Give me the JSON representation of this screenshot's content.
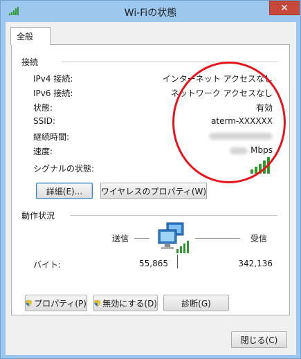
{
  "window": {
    "title": "Wi-Fiの状態",
    "close_label": "✕",
    "tab_label": "全般"
  },
  "connection": {
    "section_title": "接続",
    "rows": [
      {
        "label": "IPv4 接続:",
        "value": "インターネット アクセスなし"
      },
      {
        "label": "IPv6 接続:",
        "value": "ネットワーク アクセスなし"
      },
      {
        "label": "状態:",
        "value": "有効"
      },
      {
        "label": "SSID:",
        "value": "aterm-XXXXXX"
      },
      {
        "label": "継続時間:",
        "value": ""
      },
      {
        "label": "速度:",
        "value": "Mbps"
      }
    ],
    "signal_label": "シグナルの状態:",
    "signal_bars": 5,
    "signal_color": "#2e9a2e",
    "details_button": "詳細(E)...",
    "wireless_props_button": "ワイヤレスのプロパティ(W)"
  },
  "activity": {
    "section_title": "動作状況",
    "sent_label": "送信",
    "received_label": "受信",
    "bytes_label": "バイト:",
    "bytes_sent": "55,865",
    "bytes_received": "342,136"
  },
  "actions": {
    "properties_button": "プロパティ(P)",
    "disable_button": "無効にする(D)",
    "diagnose_button": "診断(G)"
  },
  "footer": {
    "close_button": "閉じる(C)"
  },
  "colors": {
    "window_frame": "#9cc8ef",
    "close_button": "#c7473b",
    "annotation": "#e8141c"
  }
}
